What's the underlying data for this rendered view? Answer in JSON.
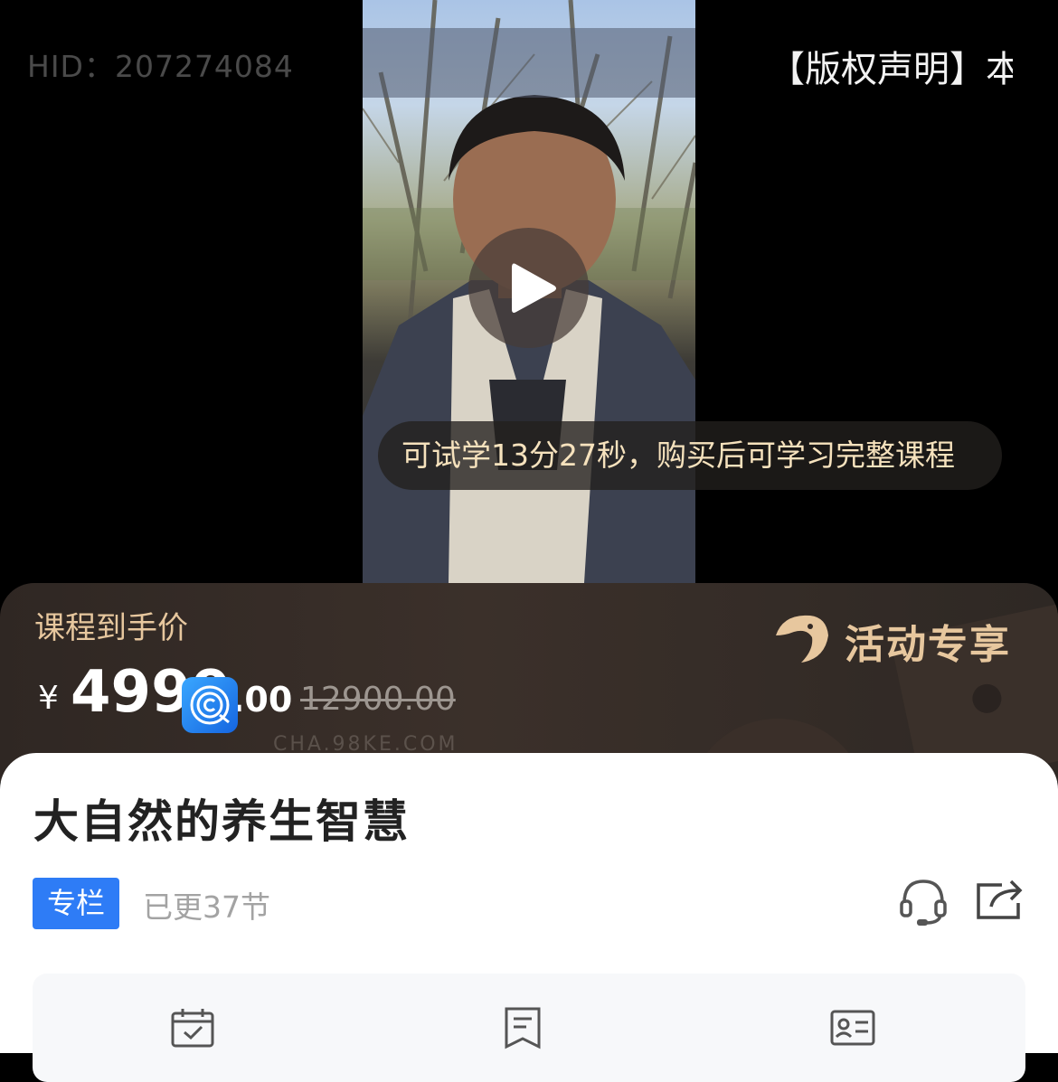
{
  "video": {
    "hid": "HID：207274084",
    "copyright": "【版权声明】本",
    "trial_notice": "可试学13分27秒，购买后可学习完整课程"
  },
  "price_panel": {
    "label": "课程到手价",
    "currency": "¥",
    "price_main": "4999",
    "price_cents": ".00",
    "original_price": "12900.00",
    "promo": "活动专享",
    "watermark": "CHA.98KE.COM",
    "colors": {
      "gold": "#e7c79e",
      "panel": "#332a25"
    }
  },
  "course": {
    "title": "大自然的养生智慧",
    "tag": "专栏",
    "updated": "已更37节",
    "accent": "#2e7cf6"
  },
  "icons": {
    "service": "headset-icon",
    "share": "share-icon",
    "features": [
      "calendar-check-icon",
      "notes-icon",
      "id-card-icon"
    ]
  }
}
